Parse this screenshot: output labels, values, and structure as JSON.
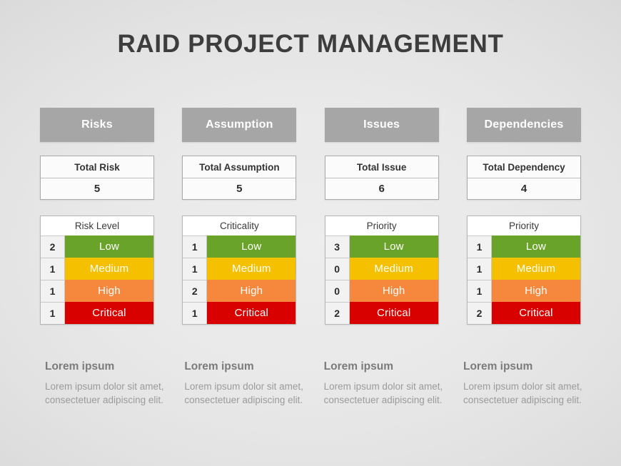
{
  "slide": {
    "title": "RAID PROJECT MANAGEMENT",
    "background_color": "#e9e9e9",
    "accent_header_color": "#a6a6a6"
  },
  "severity_colors": {
    "low": "#6aa329",
    "medium": "#f5c000",
    "high": "#f5883c",
    "critical": "#d90000"
  },
  "columns": [
    {
      "category": "Risks",
      "total_label": "Total Risk",
      "total_value": "5",
      "level_title": "Risk Level",
      "levels": [
        {
          "count": "2",
          "label": "Low"
        },
        {
          "count": "1",
          "label": "Medium"
        },
        {
          "count": "1",
          "label": "High"
        },
        {
          "count": "1",
          "label": "Critical"
        }
      ],
      "note_title": "Lorem ipsum",
      "note_body": "Lorem ipsum dolor sit amet, consectetuer adipiscing elit."
    },
    {
      "category": "Assumption",
      "total_label": "Total Assumption",
      "total_value": "5",
      "level_title": "Criticality",
      "levels": [
        {
          "count": "1",
          "label": "Low"
        },
        {
          "count": "1",
          "label": "Medium"
        },
        {
          "count": "2",
          "label": "High"
        },
        {
          "count": "1",
          "label": "Critical"
        }
      ],
      "note_title": "Lorem ipsum",
      "note_body": "Lorem ipsum dolor sit amet, consectetuer adipiscing elit."
    },
    {
      "category": "Issues",
      "total_label": "Total Issue",
      "total_value": "6",
      "level_title": "Priority",
      "levels": [
        {
          "count": "3",
          "label": "Low"
        },
        {
          "count": "0",
          "label": "Medium"
        },
        {
          "count": "0",
          "label": "High"
        },
        {
          "count": "2",
          "label": "Critical"
        }
      ],
      "note_title": "Lorem ipsum",
      "note_body": "Lorem ipsum dolor sit amet, consectetuer adipiscing elit."
    },
    {
      "category": "Dependencies",
      "total_label": "Total Dependency",
      "total_value": "4",
      "level_title": "Priority",
      "levels": [
        {
          "count": "1",
          "label": "Low"
        },
        {
          "count": "1",
          "label": "Medium"
        },
        {
          "count": "1",
          "label": "High"
        },
        {
          "count": "2",
          "label": "Critical"
        }
      ],
      "note_title": "Lorem ipsum",
      "note_body": "Lorem ipsum dolor sit amet, consectetuer adipiscing elit."
    }
  ]
}
